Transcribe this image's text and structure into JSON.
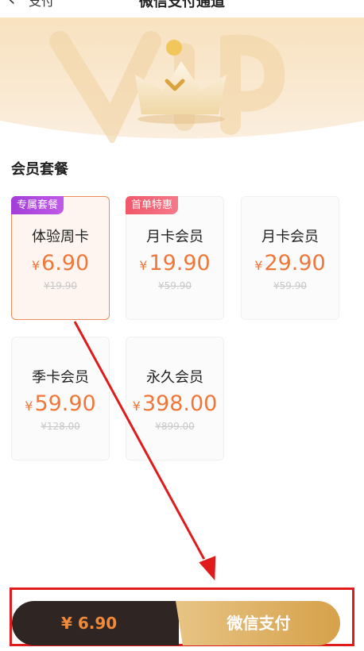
{
  "header": {
    "back_label": "支付",
    "title": "微信支付通道"
  },
  "hero": {
    "watermark": "VIP"
  },
  "section": {
    "title": "会员套餐"
  },
  "plans": [
    {
      "tag": "专属套餐",
      "tag_color": "#a23ed8",
      "name": "体验周卡",
      "currency": "¥",
      "price": "6.90",
      "original": "¥19.90",
      "selected": true
    },
    {
      "tag": "首单特惠",
      "tag_color": "#f0586a",
      "name": "月卡会员",
      "currency": "¥",
      "price": "19.90",
      "original": "¥59.90",
      "selected": false
    },
    {
      "tag": "",
      "name": "月卡会员",
      "currency": "¥",
      "price": "29.90",
      "original": "¥59.90",
      "selected": false
    },
    {
      "tag": "",
      "name": "季卡会员",
      "currency": "¥",
      "price": "59.90",
      "original": "¥128.00",
      "selected": false
    },
    {
      "tag": "",
      "name": "永久会员",
      "currency": "¥",
      "price": "398.00",
      "original": "¥899.00",
      "selected": false
    }
  ],
  "pay_bar": {
    "amount": "¥ 6.90",
    "button_label": "微信支付"
  },
  "colors": {
    "accent_price": "#f0773a",
    "selected_border": "#ee8a5c",
    "pay_dark": "#2f2522",
    "pay_gold": "#d6a14a",
    "annotation_red": "#e01b1b"
  }
}
